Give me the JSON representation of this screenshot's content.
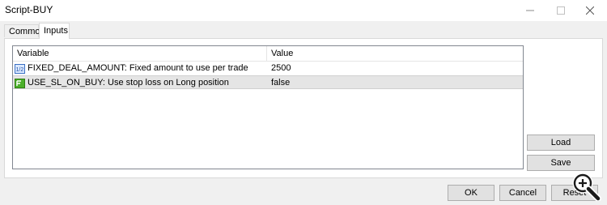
{
  "window": {
    "title": "Script-BUY",
    "minimize_icon": "minimize-icon",
    "maximize_icon": "maximize-icon",
    "close_icon": "close-icon"
  },
  "tabs": [
    {
      "label": "Common",
      "active": false
    },
    {
      "label": "Inputs",
      "active": true
    }
  ],
  "grid": {
    "columns": [
      "Variable",
      "Value"
    ],
    "rows": [
      {
        "icon": "number-param-icon",
        "variable": "FIXED_DEAL_AMOUNT: Fixed amount to use per trade",
        "value": "2500",
        "selected": false
      },
      {
        "icon": "boolean-param-icon",
        "variable": "USE_SL_ON_BUY: Use stop loss on Long position",
        "value": "false",
        "selected": true
      }
    ]
  },
  "side_buttons": {
    "load": "Load",
    "save": "Save"
  },
  "footer_buttons": {
    "ok": "OK",
    "cancel": "Cancel",
    "reset": "Reset"
  },
  "overlay": {
    "icon": "zoom-in-icon"
  }
}
